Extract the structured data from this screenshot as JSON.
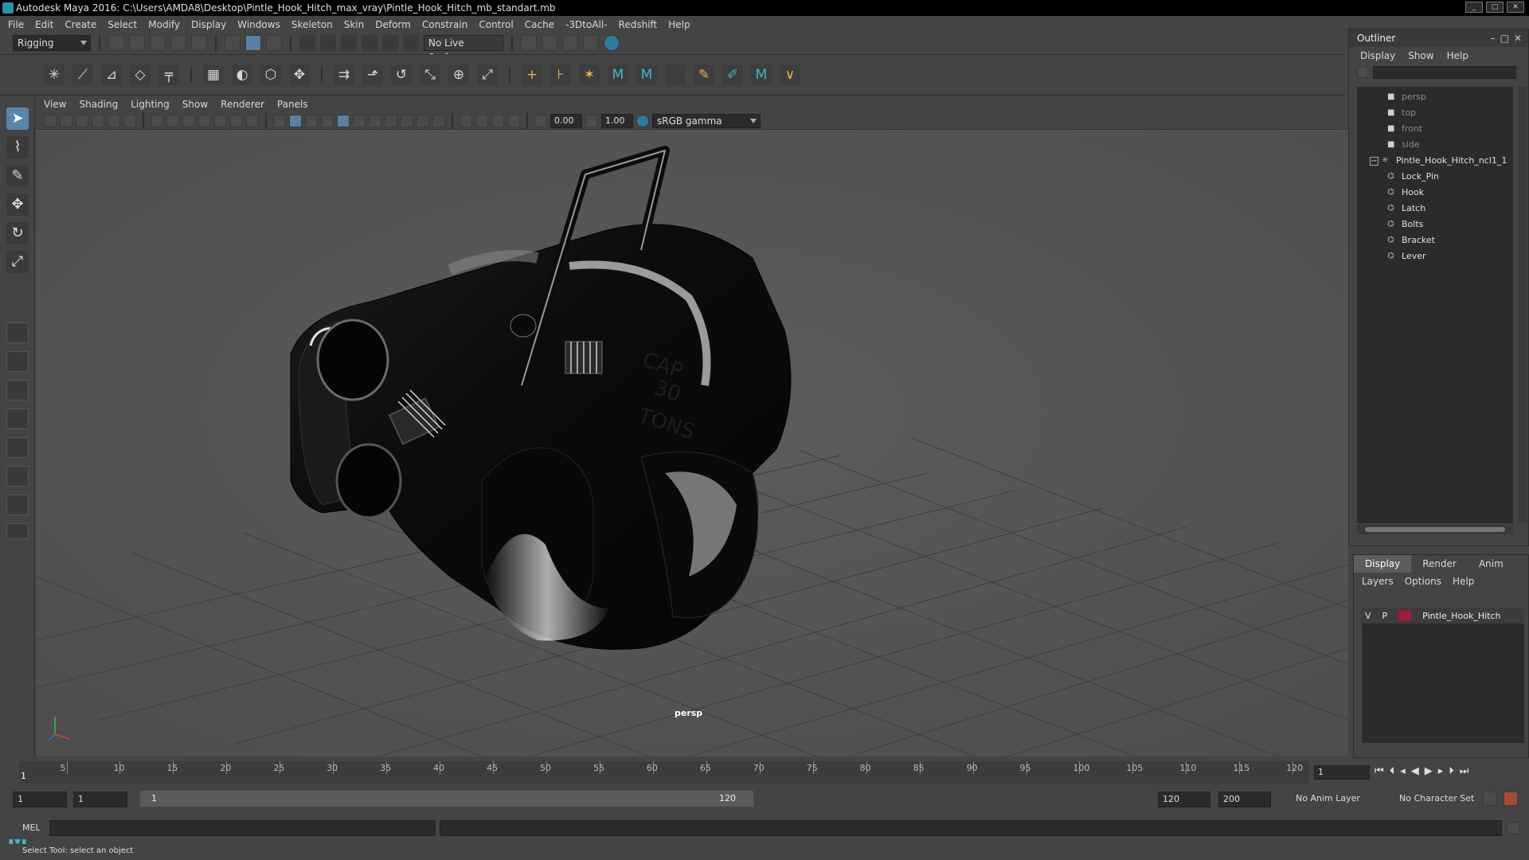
{
  "title": "Autodesk Maya 2016: C:\\Users\\AMDA8\\Desktop\\Pintle_Hook_Hitch_max_vray\\Pintle_Hook_Hitch_mb_standart.mb",
  "menu": [
    "File",
    "Edit",
    "Create",
    "Select",
    "Modify",
    "Display",
    "Windows",
    "Skeleton",
    "Skin",
    "Deform",
    "Constrain",
    "Control",
    "Cache",
    "-3DtoAll-",
    "Redshift",
    "Help"
  ],
  "status_line": {
    "mode": "Rigging",
    "live_surface": "No Live Surface"
  },
  "viewport": {
    "menu": [
      "View",
      "Shading",
      "Lighting",
      "Show",
      "Renderer",
      "Panels"
    ],
    "exposure": "0.00",
    "gamma": "1.00",
    "color_space": "sRGB gamma",
    "camera_label": "persp"
  },
  "model_text": {
    "cap_line1": "CAP",
    "cap_line2": "30",
    "cap_line3": "TONS"
  },
  "outliner": {
    "title": "Outliner",
    "menu": [
      "Display",
      "Show",
      "Help"
    ],
    "cameras": [
      "persp",
      "top",
      "front",
      "side"
    ],
    "group": "Pintle_Hook_Hitch_ncl1_1",
    "children": [
      "Lock_Pin",
      "Hook",
      "Latch",
      "Bolts",
      "Bracket",
      "Lever"
    ],
    "collapse_symbol": "−"
  },
  "layers": {
    "tabs": [
      "Display",
      "Render",
      "Anim"
    ],
    "menu": [
      "Layers",
      "Options",
      "Help"
    ],
    "row": {
      "v": "V",
      "p": "P",
      "name": "Pintle_Hook_Hitch",
      "color": "#9a1d3a"
    }
  },
  "timeline": {
    "ticks": [
      "5",
      "10",
      "15",
      "20",
      "25",
      "30",
      "35",
      "40",
      "45",
      "50",
      "55",
      "60",
      "65",
      "70",
      "75",
      "80",
      "85",
      "90",
      "95",
      "100",
      "105",
      "110",
      "115",
      "120"
    ],
    "start_label": "1",
    "current_frame": "1"
  },
  "range": {
    "start": "1",
    "anim_start": "1",
    "slider_start": "1",
    "slider_end": "120",
    "end": "120",
    "anim_end": "200",
    "anim_layer": "No Anim Layer",
    "char_set": "No Character Set"
  },
  "command": {
    "label": "MEL"
  },
  "help_line": "Select Tool: select an object"
}
